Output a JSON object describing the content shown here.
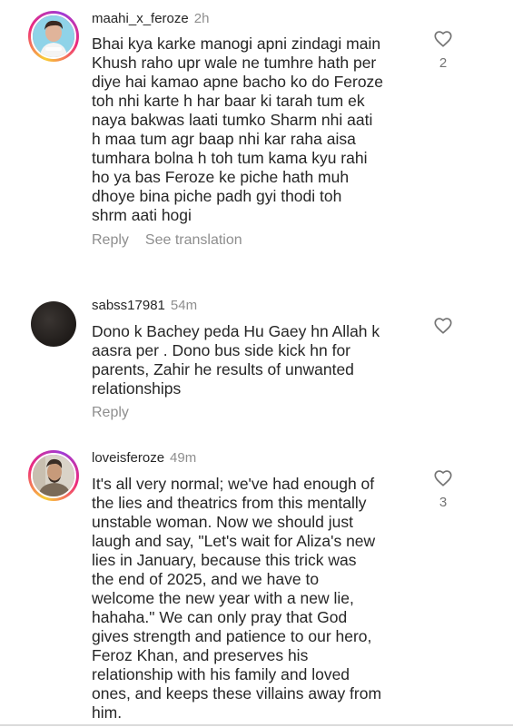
{
  "comments": [
    {
      "username": "maahi_x_feroze",
      "time": "2h",
      "lines": [
        "Bhai kya karke manogi apni zindagi main",
        "Khush raho upr wale ne tumhre hath per",
        "diye hai kamao apne bacho ko do Feroze",
        "toh nhi karte h har baar ki tarah tum ek",
        "naya bakwas laati tumko Sharm nhi aati",
        "h maa tum agr baap nhi kar raha aisa",
        "tumhara bolna h toh tum kama kyu rahi",
        "ho ya bas Feroze ke piche hath muh",
        "dhoye bina piche padh gyi thodi toh",
        "shrm aati hogi"
      ],
      "reply_label": "Reply",
      "translate_label": "See translation",
      "likes": "2",
      "icon": "heart-outline-icon"
    },
    {
      "username": "sabss17981",
      "time": "54m",
      "lines": [
        "Dono k Bachey peda Hu Gaey hn Allah k",
        "aasra per . Dono bus side kick hn for",
        "parents, Zahir he results of unwanted",
        "relationships"
      ],
      "reply_label": "Reply",
      "icon": "heart-outline-icon"
    },
    {
      "username": "loveisferoze",
      "time": "49m",
      "lines": [
        "It's all very normal; we've had enough of",
        "the lies and theatrics from this mentally",
        "unstable woman. Now we should just",
        "laugh and say, \"Let's wait for Aliza's new",
        "lies in January, because this trick was",
        "the end of 2025, and we have to",
        "welcome the new year with a new lie,",
        "hahaha.\" We can only pray that God",
        "gives strength and patience to our hero,",
        "Feroz Khan, and preserves his",
        "relationship with his family and loved",
        "ones, and keeps these villains away from",
        "him."
      ],
      "likes": "3",
      "icon": "heart-outline-icon"
    }
  ],
  "colors": {
    "text": "#262626",
    "secondary": "#8e8e8e",
    "story_ring_start": "#f9ce34",
    "story_ring_mid": "#ee2a7b",
    "story_ring_end": "#a03bd6"
  }
}
